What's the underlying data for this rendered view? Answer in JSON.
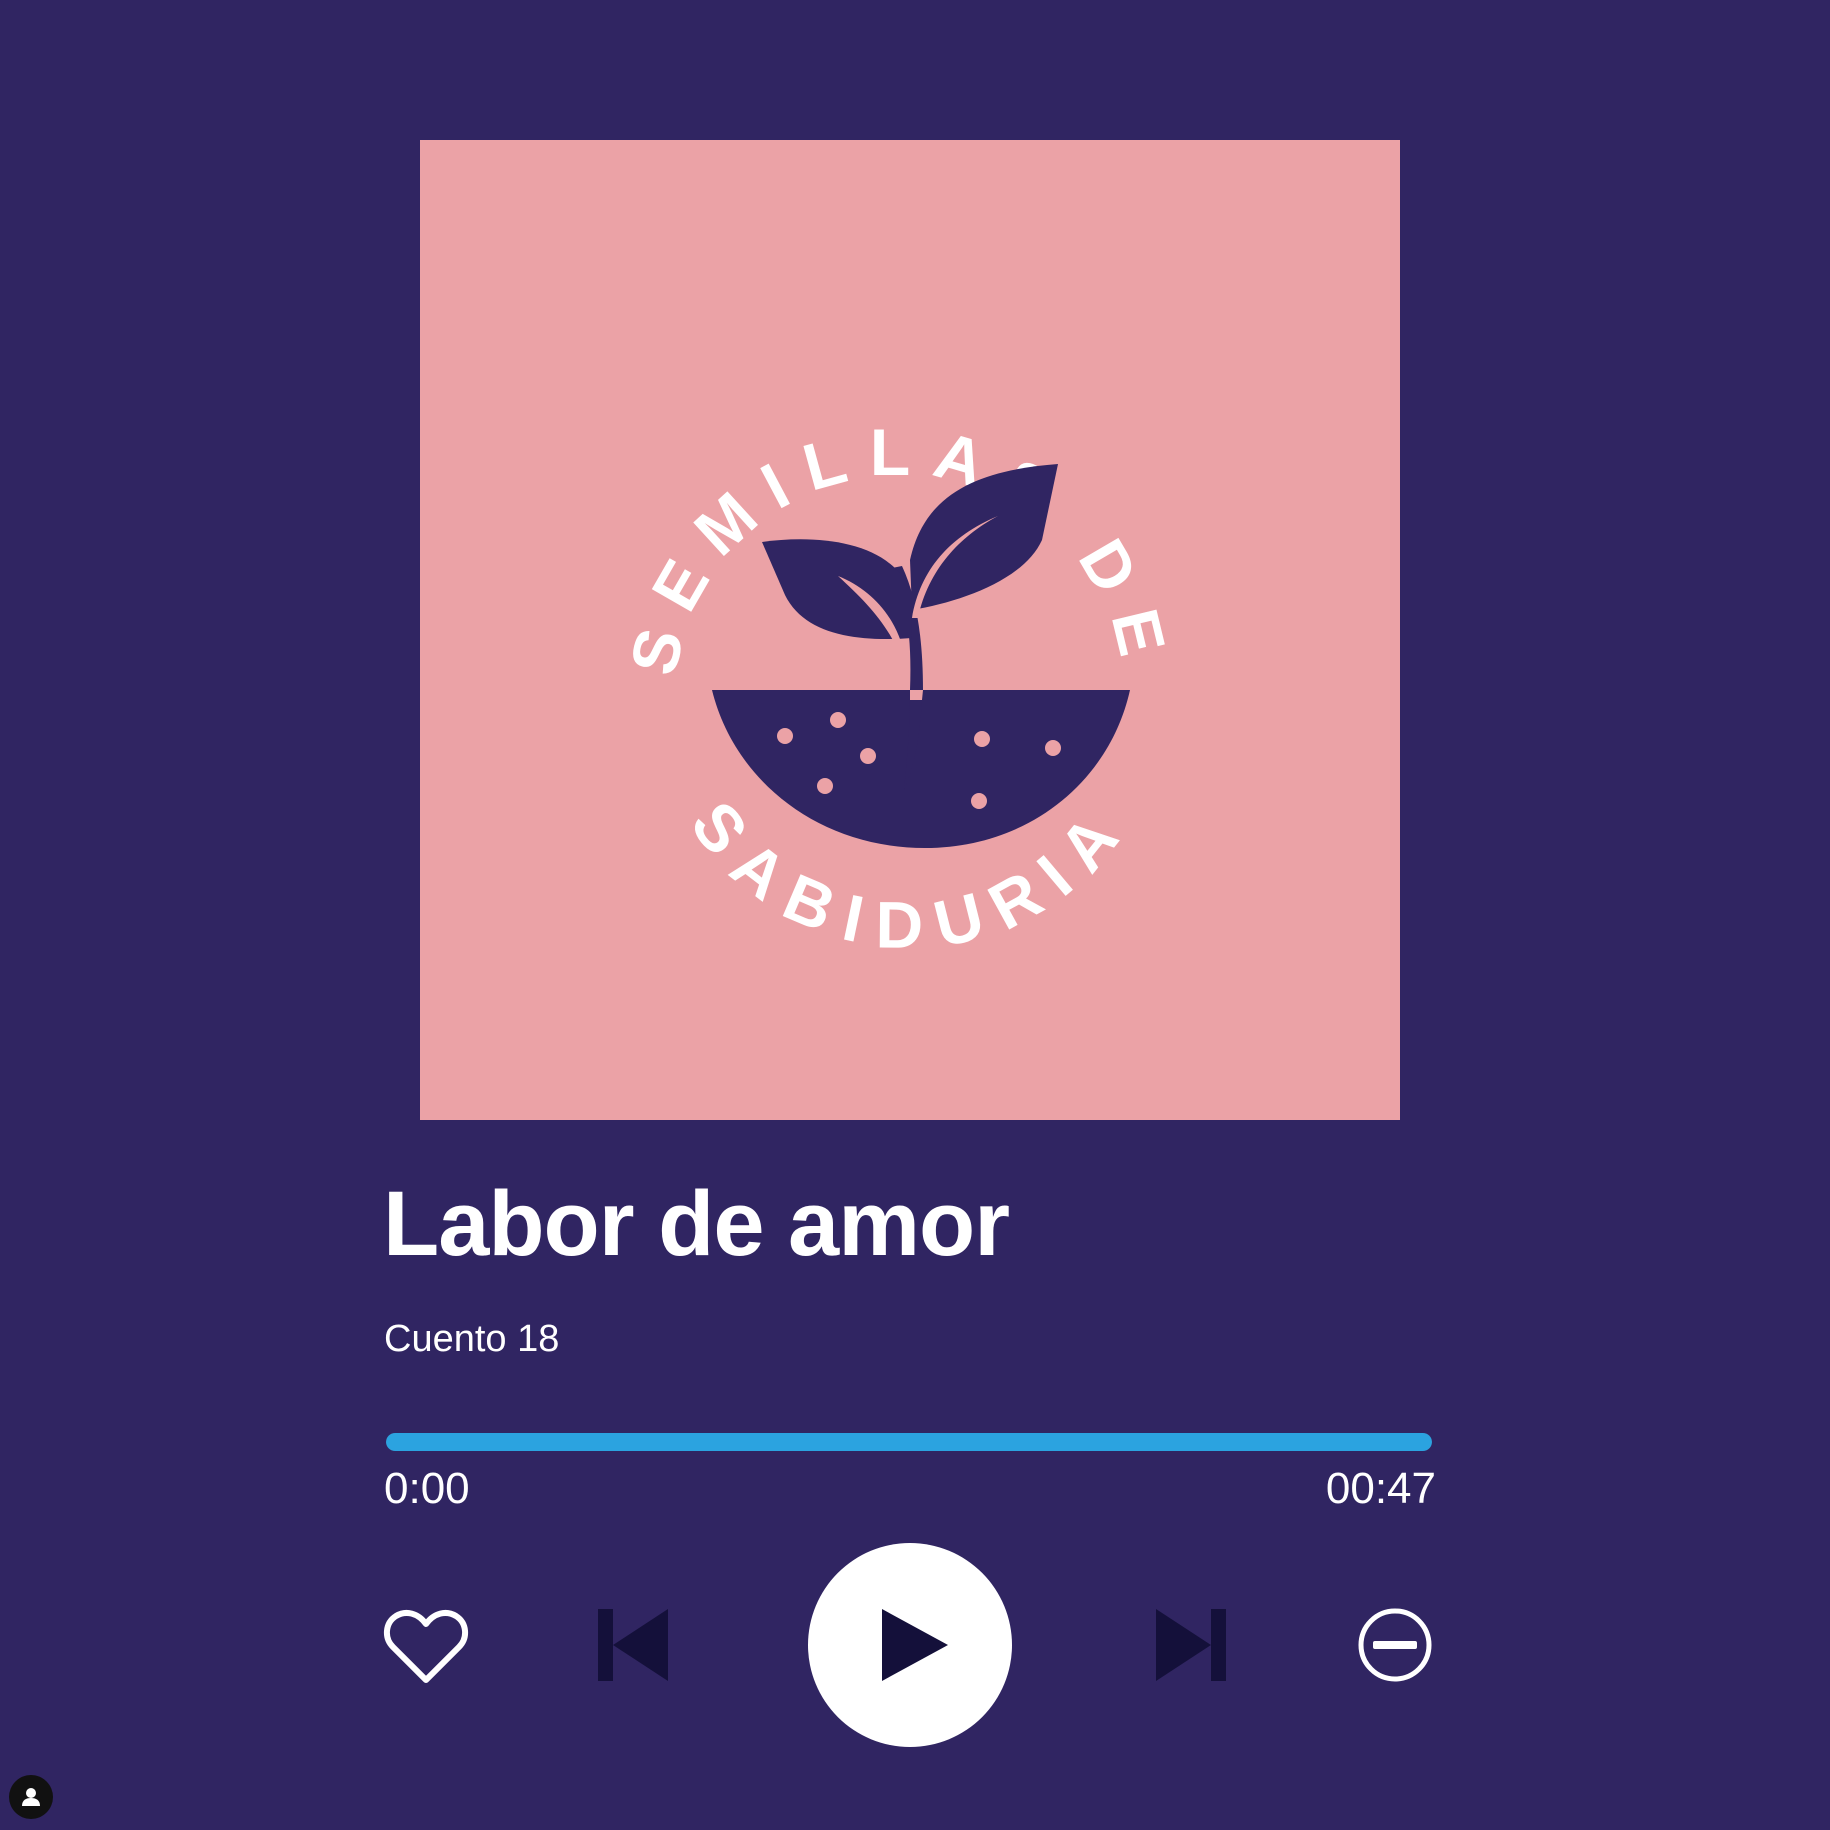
{
  "album": {
    "logo_text_top": "SEMILLAS DE",
    "logo_text_bottom": "SABIDURIA",
    "background_color": "#eba2a6",
    "ink_color": "#302562",
    "icon": "sprout-in-bowl-icon"
  },
  "track": {
    "title": "Labor de amor",
    "subtitle": "Cuento 18"
  },
  "progress": {
    "fraction": 1.0,
    "elapsed": "0:00",
    "duration": "00:47",
    "fill_color": "#2ba3e0"
  },
  "controls": {
    "like": "heart-outline-icon",
    "previous": "skip-previous-icon",
    "play": "play-icon",
    "next": "skip-next-icon",
    "remove": "minus-circle-icon"
  },
  "colors": {
    "background": "#302562",
    "text": "#ffffff",
    "play_button": "#ffffff",
    "skip_icons": "#14103a"
  },
  "footer": {
    "profile_icon": "user-avatar-icon"
  }
}
